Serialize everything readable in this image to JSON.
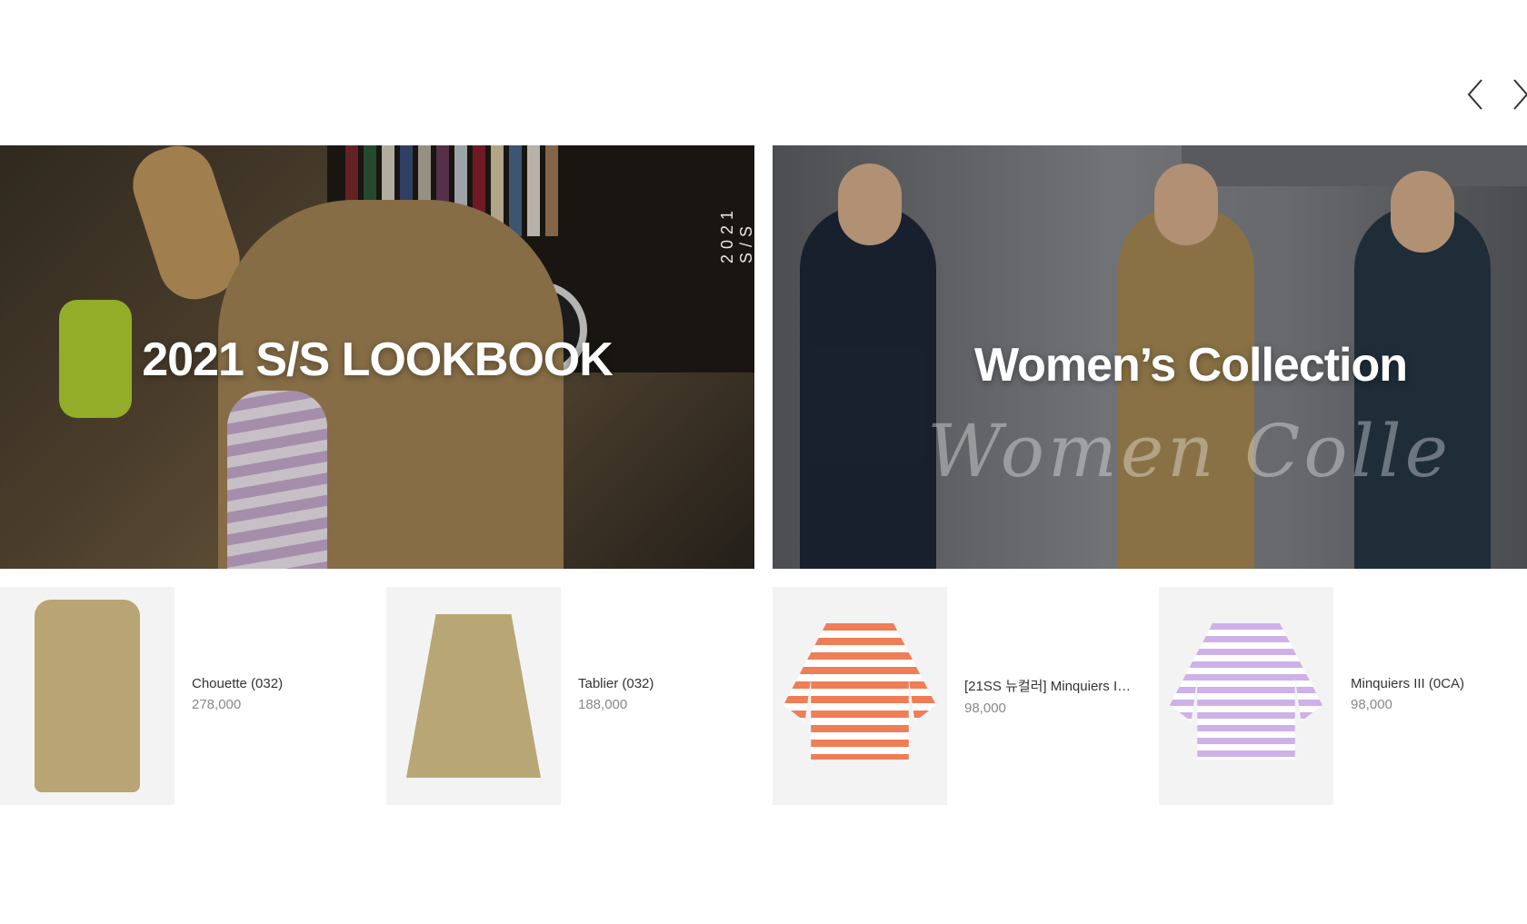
{
  "carousel": {
    "prev_icon": "chevron-left-icon",
    "next_icon": "chevron-right-icon"
  },
  "banners": [
    {
      "title": "2021 S/S LOOKBOOK",
      "vertical_tag": "2021 S/S"
    },
    {
      "title": "Women’s Collection",
      "script_text": "Women Colle"
    }
  ],
  "products": [
    {
      "name": "Chouette (032)",
      "price": "278,000"
    },
    {
      "name": "Tablier (032)",
      "price": "188,000"
    },
    {
      "name": "[21SS 뉴컬러] Minquiers III...",
      "price": "98,000"
    },
    {
      "name": "Minquiers III (0CA)",
      "price": "98,000"
    }
  ]
}
